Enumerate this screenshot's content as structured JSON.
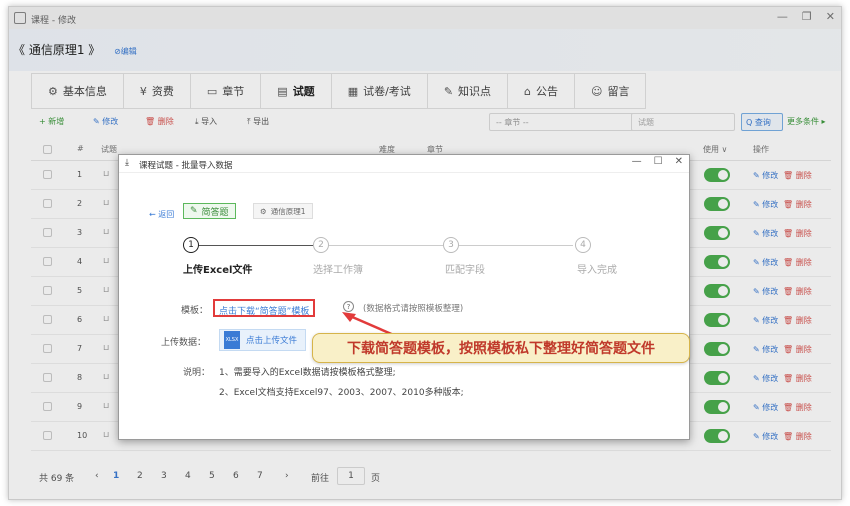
{
  "window": {
    "title": "课程 - 修改",
    "controls": [
      "—",
      "❐",
      "✕"
    ]
  },
  "breadcrumb": {
    "title": "《 通信原理1 》",
    "edit": "⊘编辑"
  },
  "tabs": [
    {
      "icon": "⚙",
      "label": "基本信息",
      "name": "tab-basic-info"
    },
    {
      "icon": "¥",
      "label": "资费",
      "name": "tab-fees"
    },
    {
      "icon": "▭",
      "label": "章节",
      "name": "tab-chapters"
    },
    {
      "icon": "▤",
      "label": "试题",
      "name": "tab-questions"
    },
    {
      "icon": "▦",
      "label": "试卷/考试",
      "name": "tab-exams"
    },
    {
      "icon": "✎",
      "label": "知识点",
      "name": "tab-knowledge"
    },
    {
      "icon": "⌂",
      "label": "公告",
      "name": "tab-notice"
    },
    {
      "icon": "☺",
      "label": "留言",
      "name": "tab-messages"
    }
  ],
  "toolbar": {
    "add": "+ 新增",
    "edit": "✎ 修改",
    "delete": "🗑 删除",
    "import": "⤓ 导入",
    "export": "⤒ 导出",
    "chapter_select": "-- 章节 --",
    "search_placeholder": "试题",
    "search_button": "Q 查询",
    "more": "更多条件 ▸"
  },
  "table": {
    "headers": {
      "num": "#",
      "question": "试题",
      "difficulty": "难度",
      "chapter": "章节",
      "enabled": "使用 ∨",
      "ops": "操作"
    },
    "rows": [
      "1",
      "2",
      "3",
      "4",
      "5",
      "6",
      "7",
      "8",
      "9",
      "10"
    ],
    "op_edit": "✎ 修改",
    "op_delete": "🗑 删除"
  },
  "pager": {
    "total": "共 69 条",
    "prev": "‹",
    "pages": [
      "1",
      "2",
      "3",
      "4",
      "5",
      "6",
      "7"
    ],
    "next": "›",
    "goto_label": "前往",
    "goto_value": "1",
    "page_suffix": "页"
  },
  "modal": {
    "title": "课程试题 - 批量导入数据",
    "back": "⇜ 返回",
    "type_tag": "简答题",
    "course_tag": "通信原理1",
    "steps": [
      {
        "num": "1",
        "label": "上传Excel文件"
      },
      {
        "num": "2",
        "label": "选择工作簿"
      },
      {
        "num": "3",
        "label": "匹配字段"
      },
      {
        "num": "4",
        "label": "导入完成"
      }
    ],
    "template_label": "模板：",
    "template_link": "点击下载“简答题”模板",
    "template_hint": "(数据格式请按照模板整理)",
    "upload_label": "上传数据：",
    "upload_button": "点击上传文件",
    "notes_label": "说明：",
    "note1": "1、需要导入的Excel数据请按模板格式整理;",
    "note2": "2、Excel文档支持Excel97、2003、2007、2010多种版本;"
  },
  "callout": "下载简答题模板，按照模板私下整理好简答题文件"
}
